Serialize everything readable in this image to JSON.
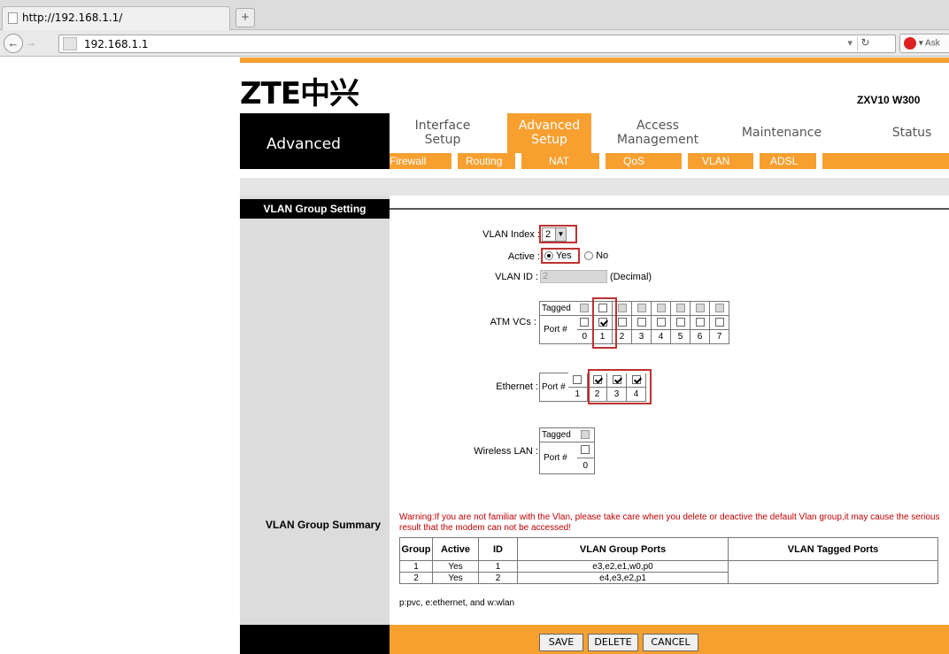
{
  "browser": {
    "tab_title": "http://192.168.1.1/",
    "new_tab": "+",
    "url": "192.168.1.1",
    "search_engine": "Ask"
  },
  "header": {
    "logo": "ZTE中兴",
    "model": "ZXV10 W300",
    "section_label": "Advanced"
  },
  "main_nav": [
    {
      "label": "Interface\nSetup",
      "active": false
    },
    {
      "label": "Advanced\nSetup",
      "active": true
    },
    {
      "label": "Access\nManagement",
      "active": false
    },
    {
      "label": "Maintenance",
      "active": false
    },
    {
      "label": "Status",
      "active": false
    }
  ],
  "sub_nav": [
    "Firewall",
    "Routing",
    "NAT",
    "QoS",
    "VLAN",
    "ADSL"
  ],
  "form": {
    "section_title": "VLAN Group Setting",
    "vlan_index_label": "VLAN Index :",
    "vlan_index_value": "2",
    "active_label": "Active :",
    "active_yes": "Yes",
    "active_no": "No",
    "vlan_id_label": "VLAN ID :",
    "vlan_id_value": "2",
    "vlan_id_unit": "(Decimal)",
    "atm_label": "ATM VCs :",
    "tagged_label": "Tagged",
    "port_label": "Port #",
    "atm_ports": [
      "0",
      "1",
      "2",
      "3",
      "4",
      "5",
      "6",
      "7"
    ],
    "ethernet_label": "Ethernet :",
    "eth_ports": [
      "1",
      "2",
      "3",
      "4"
    ],
    "wlan_label": "Wireless LAN :",
    "wlan_ports": [
      "0"
    ]
  },
  "summary": {
    "section_title": "VLAN Group Summary",
    "warning": "Warning:If you are not familiar with the Vlan, please take care when you delete or deactive the default Vlan group,it may cause the serious result that the modem can not be accessed!",
    "headers": [
      "Group",
      "Active",
      "ID",
      "VLAN Group Ports",
      "VLAN Tagged Ports"
    ],
    "rows": [
      [
        "1",
        "Yes",
        "1",
        "e3,e2,e1,w0,p0",
        ""
      ],
      [
        "2",
        "Yes",
        "2",
        "e4,e3,e2,p1",
        ""
      ]
    ],
    "note": "p:pvc, e:ethernet, and w:wlan"
  },
  "buttons": {
    "save": "SAVE",
    "delete": "DELETE",
    "cancel": "CANCEL"
  }
}
